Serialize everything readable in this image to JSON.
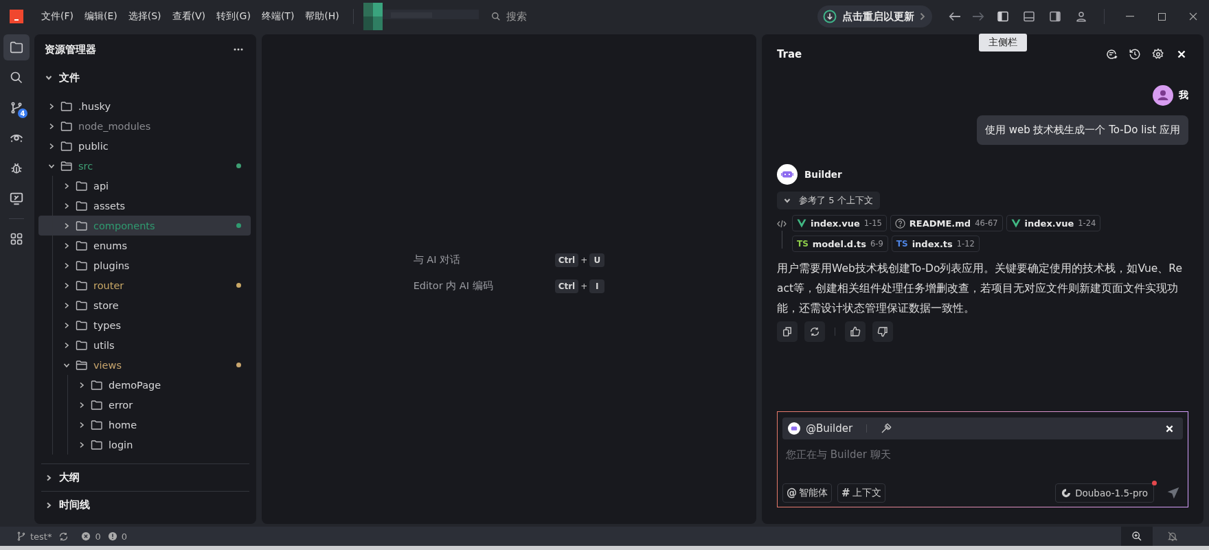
{
  "menu": [
    "文件(F)",
    "编辑(E)",
    "选择(S)",
    "查看(V)",
    "转到(G)",
    "终端(T)",
    "帮助(H)"
  ],
  "search": {
    "placeholder": "搜索"
  },
  "update_button": {
    "label": "点击重启以更新"
  },
  "layout_buttons": [
    {
      "kind": "primary-sidebar",
      "selected": true,
      "tooltip": "主侧栏"
    },
    {
      "kind": "panel",
      "selected": false
    },
    {
      "kind": "secondary-sidebar",
      "selected": false
    },
    {
      "kind": "account",
      "selected": false
    }
  ],
  "activity_bar": [
    {
      "kind": "files",
      "selected": true
    },
    {
      "kind": "search",
      "selected": false
    },
    {
      "kind": "source-control",
      "selected": false,
      "badge": "4"
    },
    {
      "kind": "watch",
      "selected": false
    },
    {
      "kind": "debug",
      "selected": false
    },
    {
      "kind": "remote",
      "selected": false
    },
    {
      "kind": "extensions",
      "selected": false
    }
  ],
  "explorer": {
    "title": "资源管理器",
    "section": {
      "label": "文件",
      "expanded": true
    },
    "tree": [
      {
        "name": ".husky",
        "expanded": false,
        "selected": false,
        "dimmed": false
      },
      {
        "name": "node_modules",
        "expanded": false,
        "selected": false,
        "dimmed": true
      },
      {
        "name": "public",
        "expanded": false,
        "selected": false,
        "dimmed": false
      },
      {
        "name": "src",
        "expanded": true,
        "selected": false,
        "dimmed": false,
        "color": "#3f9f74",
        "children": [
          {
            "name": "api",
            "expanded": false,
            "selected": false,
            "dimmed": false
          },
          {
            "name": "assets",
            "expanded": false,
            "selected": false,
            "dimmed": false
          },
          {
            "name": "components",
            "expanded": false,
            "selected": true,
            "dimmed": false,
            "color": "#2f9b70"
          },
          {
            "name": "enums",
            "expanded": false,
            "selected": false,
            "dimmed": false
          },
          {
            "name": "plugins",
            "expanded": false,
            "selected": false,
            "dimmed": false
          },
          {
            "name": "router",
            "expanded": false,
            "selected": false,
            "dimmed": false,
            "color": "#c9a866"
          },
          {
            "name": "store",
            "expanded": false,
            "selected": false,
            "dimmed": false
          },
          {
            "name": "types",
            "expanded": false,
            "selected": false,
            "dimmed": false
          },
          {
            "name": "utils",
            "expanded": false,
            "selected": false,
            "dimmed": false
          },
          {
            "name": "views",
            "expanded": true,
            "selected": false,
            "dimmed": false,
            "color": "#c9a66e",
            "children": [
              {
                "name": "demoPage",
                "expanded": false,
                "selected": false,
                "dimmed": false
              },
              {
                "name": "error",
                "expanded": false,
                "selected": false,
                "dimmed": false
              },
              {
                "name": "home",
                "expanded": false,
                "selected": false,
                "dimmed": false
              },
              {
                "name": "login",
                "expanded": false,
                "selected": false,
                "dimmed": false
              }
            ]
          }
        ]
      }
    ],
    "other_sections": [
      {
        "label": "大纲",
        "expanded": false
      },
      {
        "label": "时间线",
        "expanded": false
      }
    ]
  },
  "editor": {
    "shortcuts": [
      {
        "label": "与 AI 对话",
        "keys": [
          "Ctrl",
          "U"
        ],
        "joiner": "+"
      },
      {
        "label": "Editor 内 AI 编码",
        "keys": [
          "Ctrl",
          "I"
        ],
        "joiner": "+"
      }
    ]
  },
  "chat": {
    "title": "Trae",
    "user": {
      "name": "我",
      "message": "使用 web 技术栈生成一个 To-Do list 应用"
    },
    "assistant": {
      "name": "Builder",
      "context_toggle": {
        "label": "参考了 5 个上下文",
        "expanded": true
      },
      "references": [
        {
          "kind": "vue",
          "name": "index.vue",
          "range": "1-15"
        },
        {
          "kind": "doc",
          "name": "README.md",
          "range": "46-67"
        },
        {
          "kind": "vue",
          "name": "index.vue",
          "range": "1-24"
        },
        {
          "kind": "ts",
          "badge": "TS",
          "color": "#8fcf4a",
          "name": "model.d.ts",
          "range": "6-9"
        },
        {
          "kind": "ts",
          "badge": "TS",
          "color": "#4f86e6",
          "name": "index.ts",
          "range": "1-12"
        }
      ],
      "reply": "用户需要用Web技术栈创建To-Do列表应用。关键要确定使用的技术栈，如Vue、React等，创建相关组件处理任务增删改查，若项目无对应文件则新建页面文件实现功能，还需设计状态管理保证数据一致性。"
    },
    "composer": {
      "agent": "@Builder",
      "placeholder": "您正在与 Builder 聊天",
      "chips": [
        {
          "symbol": "@",
          "label": "智能体"
        },
        {
          "symbol": "#",
          "label": "上下文"
        }
      ],
      "model": "Doubao-1.5-pro",
      "model_notice": true
    }
  },
  "status_bar": {
    "branch": "test*",
    "errors": "0",
    "warnings": "0"
  }
}
